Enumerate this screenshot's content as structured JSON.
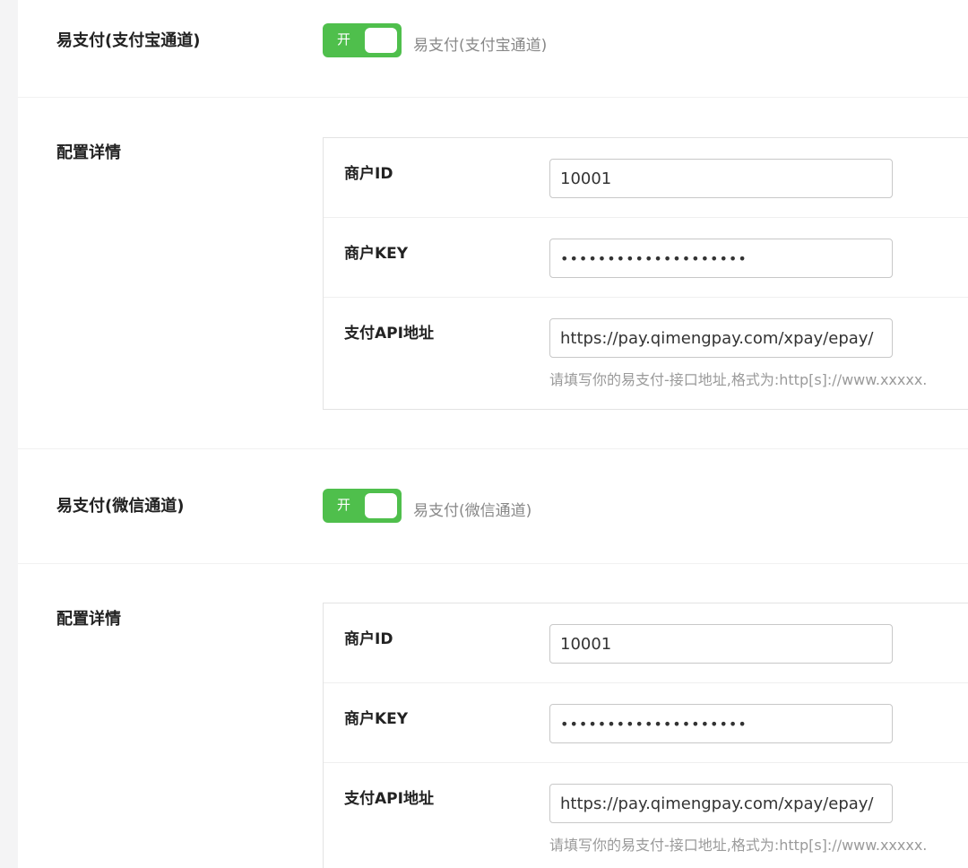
{
  "sections": [
    {
      "name": "易支付(支付宝通道)",
      "toggle_label": "开",
      "toggle_desc": "易支付(支付宝通道)",
      "config_title": "配置详情",
      "fields": {
        "merchant_id_label": "商户ID",
        "merchant_id_value": "10001",
        "merchant_key_label": "商户KEY",
        "merchant_key_value": "••••••••••••••••••••",
        "api_label": "支付API地址",
        "api_value": "https://pay.qimengpay.com/xpay/epay/",
        "api_hint": "请填写你的易支付-接口地址,格式为:http[s]://www.xxxxx."
      }
    },
    {
      "name": "易支付(微信通道)",
      "toggle_label": "开",
      "toggle_desc": "易支付(微信通道)",
      "config_title": "配置详情",
      "fields": {
        "merchant_id_label": "商户ID",
        "merchant_id_value": "10001",
        "merchant_key_label": "商户KEY",
        "merchant_key_value": "••••••••••••••••••••",
        "api_label": "支付API地址",
        "api_value": "https://pay.qimengpay.com/xpay/epay/",
        "api_hint": "请填写你的易支付-接口地址,格式为:http[s]://www.xxxxx."
      }
    }
  ],
  "colors": {
    "toggle_on": "#4fbf4c",
    "label_text": "#222222",
    "muted_text": "#888888"
  }
}
